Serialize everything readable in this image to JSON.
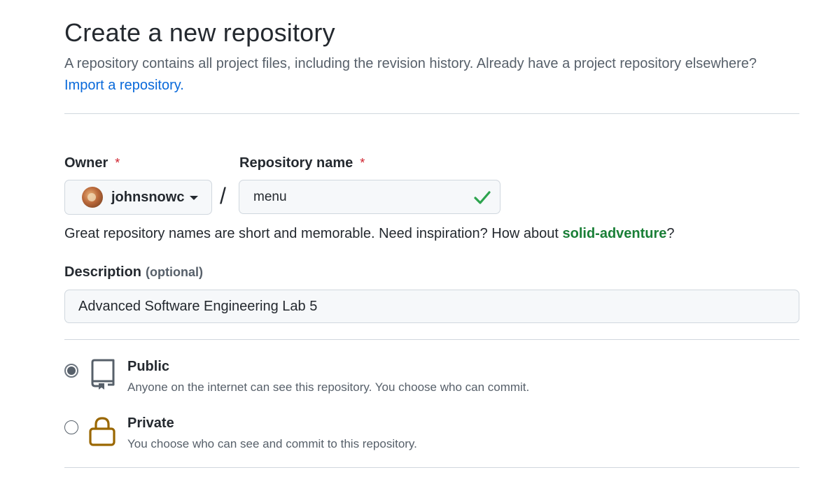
{
  "header": {
    "title": "Create a new repository",
    "subtitle": "A repository contains all project files, including the revision history. Already have a project repository elsewhere?",
    "import_link": "Import a repository."
  },
  "owner": {
    "label": "Owner",
    "required_mark": "*",
    "value": "johnsnowc"
  },
  "repo_name": {
    "label": "Repository name",
    "required_mark": "*",
    "value": "menu",
    "separator": "/"
  },
  "hint": {
    "text": "Great repository names are short and memorable. Need inspiration? How about ",
    "suggestion": "solid-adventure",
    "end": "?"
  },
  "description": {
    "label": "Description",
    "optional": "(optional)",
    "value": "Advanced Software Engineering Lab 5"
  },
  "visibility": {
    "selected": "public",
    "options": [
      {
        "title": "Public",
        "desc": "Anyone on the internet can see this repository. You choose who can commit.",
        "icon": "repo-icon"
      },
      {
        "title": "Private",
        "desc": "You choose who can see and commit to this repository.",
        "icon": "lock-icon"
      }
    ]
  },
  "colors": {
    "link": "#0969da",
    "success": "#1a7f37",
    "required": "#cf222e",
    "lock": "#9a6700"
  }
}
